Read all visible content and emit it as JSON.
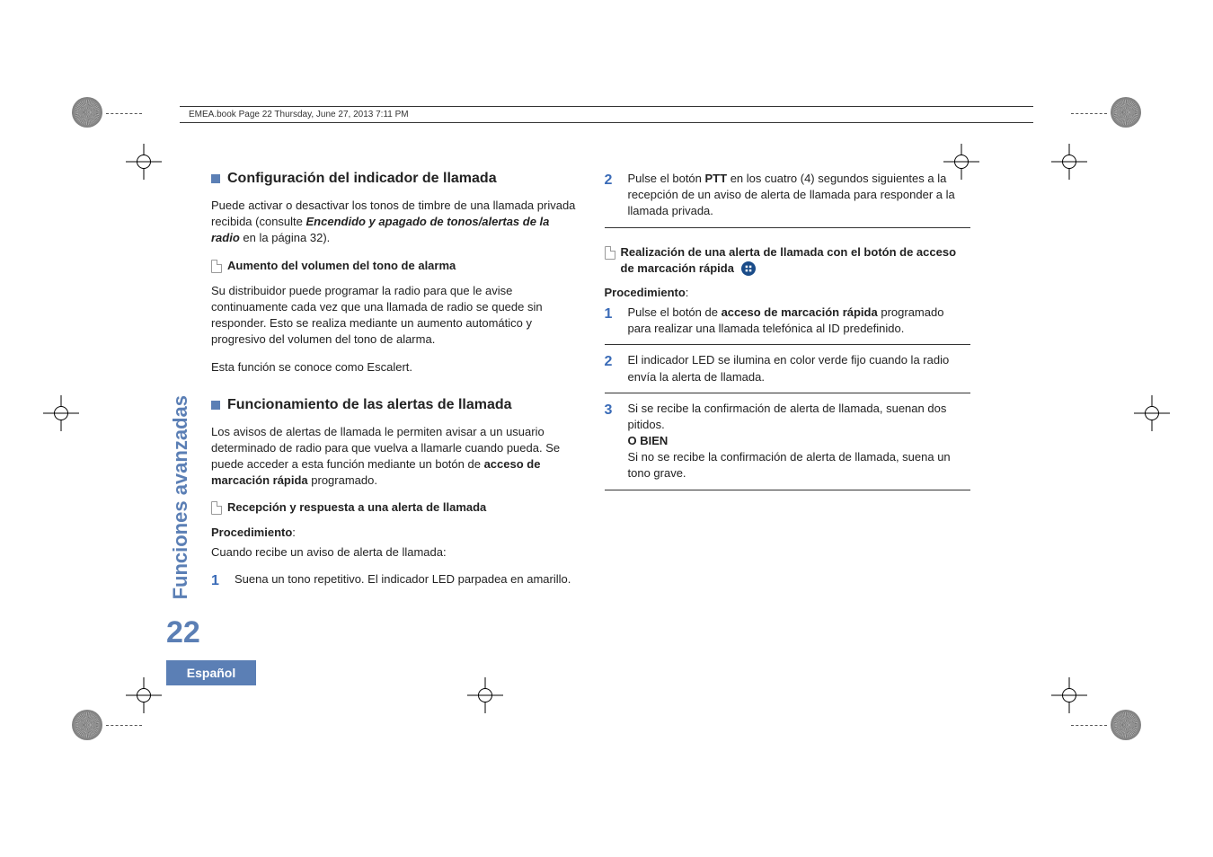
{
  "header": {
    "page_info": "EMEA.book  Page 22  Thursday, June 27, 2013  7:11 PM"
  },
  "side": {
    "section": "Funciones avanzadas",
    "page_number": "22",
    "language": "Español"
  },
  "left": {
    "h1": "Configuración del indicador de llamada",
    "p1_a": "Puede activar o desactivar los tonos de timbre de una llamada privada recibida (consulte ",
    "p1_b": "Encendido y apagado de tonos/alertas de la radio",
    "p1_c": " en la página 32).",
    "sub1": "Aumento del volumen del tono de alarma",
    "p2": "Su distribuidor puede programar la radio para que le avise continuamente cada vez que una llamada de radio se quede sin responder. Esto se realiza mediante un aumento automático y progresivo del volumen del tono de alarma.",
    "p3": "Esta función se conoce como Escalert.",
    "h2": "Funcionamiento de las alertas de llamada",
    "p4_a": "Los avisos de alertas de llamada le permiten avisar a un usuario determinado de radio para que vuelva a llamarle cuando pueda. Se puede acceder a esta función mediante un botón de ",
    "p4_b": "acceso de marcación rápida",
    "p4_c": " programado.",
    "sub2": "Recepción y respuesta a una alerta de llamada",
    "proc_label_a": "Procedimiento",
    "proc_label_b": ":",
    "proc_line": "Cuando recibe un aviso de alerta de llamada:",
    "steps": [
      {
        "n": "1",
        "text": "Suena un tono repetitivo. El indicador LED parpadea en amarillo."
      }
    ]
  },
  "right": {
    "cont_steps": [
      {
        "n": "2",
        "text_a": "Pulse el botón ",
        "text_b": "PTT",
        "text_c": " en los cuatro (4) segundos siguientes a la recepción de un aviso de alerta de llamada para responder a la llamada privada."
      }
    ],
    "sub1": "Realización de una alerta de llamada con el botón de acceso de marcación rápida",
    "proc_label_a": "Procedimiento",
    "proc_label_b": ":",
    "steps": [
      {
        "n": "1",
        "text_a": "Pulse el botón de ",
        "text_b": "acceso de marcación rápida",
        "text_c": " programado para realizar una llamada telefónica al ID predefinido."
      },
      {
        "n": "2",
        "text": "El indicador LED se ilumina en color verde fijo cuando la radio envía la alerta de llamada."
      },
      {
        "n": "3",
        "text_a": "Si se recibe la confirmación de alerta de llamada, suenan dos pitidos.",
        "text_b": "O BIEN",
        "text_c": "Si no se recibe la confirmación de alerta de llamada, suena un tono grave."
      }
    ]
  }
}
